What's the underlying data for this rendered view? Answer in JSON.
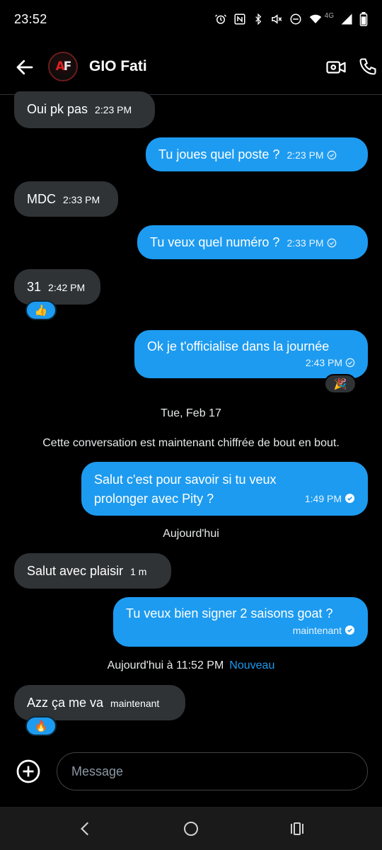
{
  "status_bar": {
    "time": "23:52",
    "network": "4G"
  },
  "header": {
    "contact_name": "GIO Fati",
    "avatar_initials_a": "A",
    "avatar_initials_f": "F"
  },
  "messages": [
    {
      "text": "Oui pk pas",
      "time": "2:23 PM"
    },
    {
      "text": "Tu joues quel poste ?",
      "time": "2:23 PM"
    },
    {
      "text": "MDC",
      "time": "2:33 PM"
    },
    {
      "text": "Tu veux quel numéro ?",
      "time": "2:33 PM"
    },
    {
      "text": "31",
      "time": "2:42 PM",
      "reaction": "👍"
    },
    {
      "text": "Ok je t'officialise dans la journée",
      "time": "2:43 PM",
      "reaction": "🎉"
    },
    {
      "line1": "Salut c'est pour savoir si tu veux",
      "line2": "prolonger avec Pity ?",
      "time": "1:49 PM"
    },
    {
      "text": "Salut avec plaisir",
      "time": "1 m"
    },
    {
      "text": "Tu veux bien signer 2 saisons goat ?",
      "time": "maintenant"
    },
    {
      "text": "Azz ça me va",
      "time": "maintenant",
      "reaction": "🔥"
    }
  ],
  "dividers": {
    "date": "Tue, Feb 17",
    "encryption": "Cette conversation est maintenant chiffrée de bout en bout.",
    "today": "Aujourd'hui",
    "today_time": "Aujourd'hui à 11:52 PM",
    "new_label": "Nouveau"
  },
  "composer": {
    "placeholder": "Message"
  },
  "colors": {
    "sent_bubble": "#1d9bf0",
    "received_bubble": "#2f3336",
    "background": "#000000"
  }
}
